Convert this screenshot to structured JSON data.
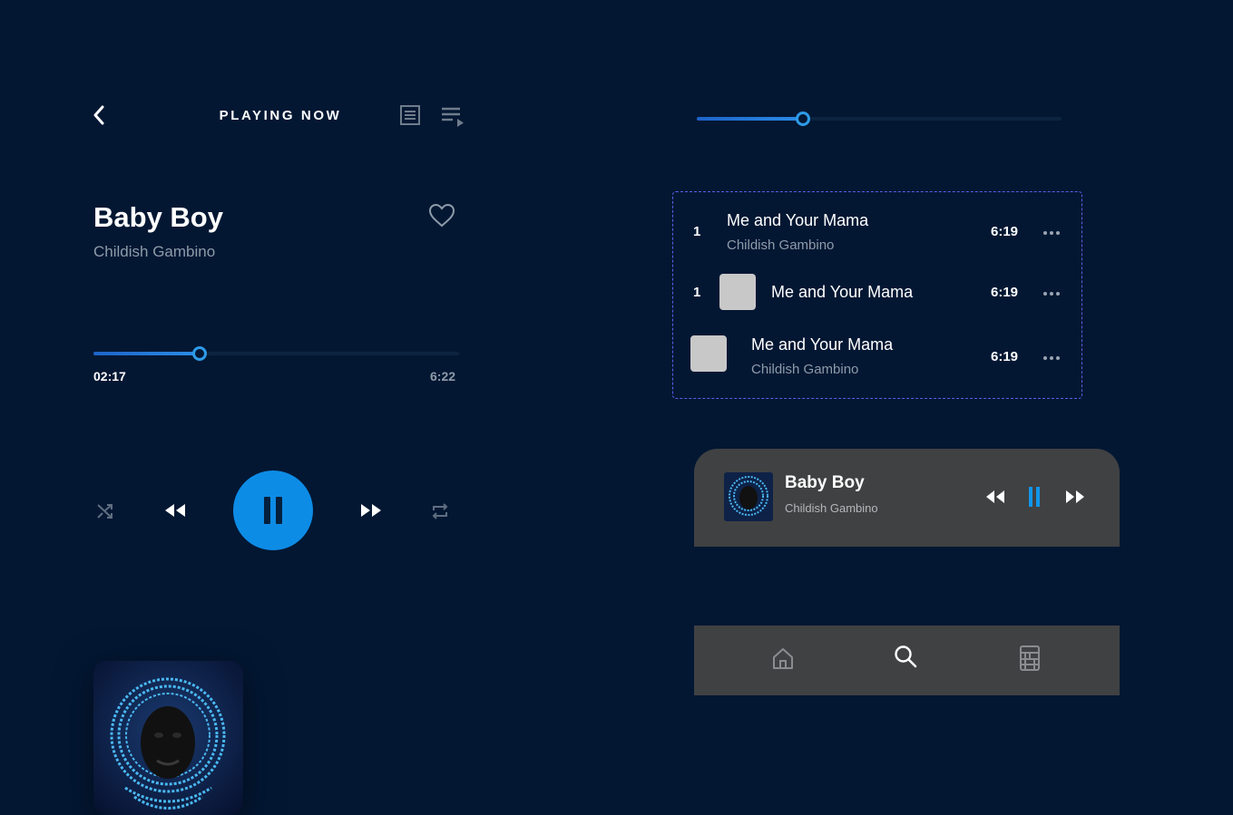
{
  "header": {
    "title": "PLAYING NOW",
    "back_icon": "chevron-left-icon",
    "lyrics_icon": "lyrics-icon",
    "queue_icon": "queue-icon"
  },
  "track": {
    "title": "Baby Boy",
    "artist": "Childish Gambino",
    "favorite_icon": "heart-icon"
  },
  "progress": {
    "current": "02:17",
    "total": "6:22",
    "fraction": 0.29
  },
  "controls": {
    "shuffle_icon": "shuffle-icon",
    "previous_icon": "rewind-icon",
    "play_pause_icon": "pause-icon",
    "next_icon": "fast-forward-icon",
    "repeat_icon": "repeat-icon"
  },
  "slider": {
    "fraction": 0.29
  },
  "tracklist": {
    "rows": [
      {
        "number": "1",
        "title": "Me and Your Mama",
        "artist": "Childish Gambino",
        "duration": "6:19"
      },
      {
        "number": "1",
        "title": "Me and Your Mama",
        "duration": "6:19"
      },
      {
        "title": "Me and Your Mama",
        "artist": "Childish Gambino",
        "duration": "6:19"
      }
    ]
  },
  "mini_player": {
    "title": "Baby Boy",
    "artist": "Childish Gambino"
  },
  "tabbar": {
    "items": [
      {
        "icon": "home-icon"
      },
      {
        "icon": "search-icon"
      },
      {
        "icon": "library-icon"
      }
    ]
  },
  "colors": {
    "background": "#031733",
    "accent": "#0d8ce6",
    "panel": "#404142",
    "muted_text": "#8e9ba9",
    "dashed_border": "#5b5ee8"
  }
}
